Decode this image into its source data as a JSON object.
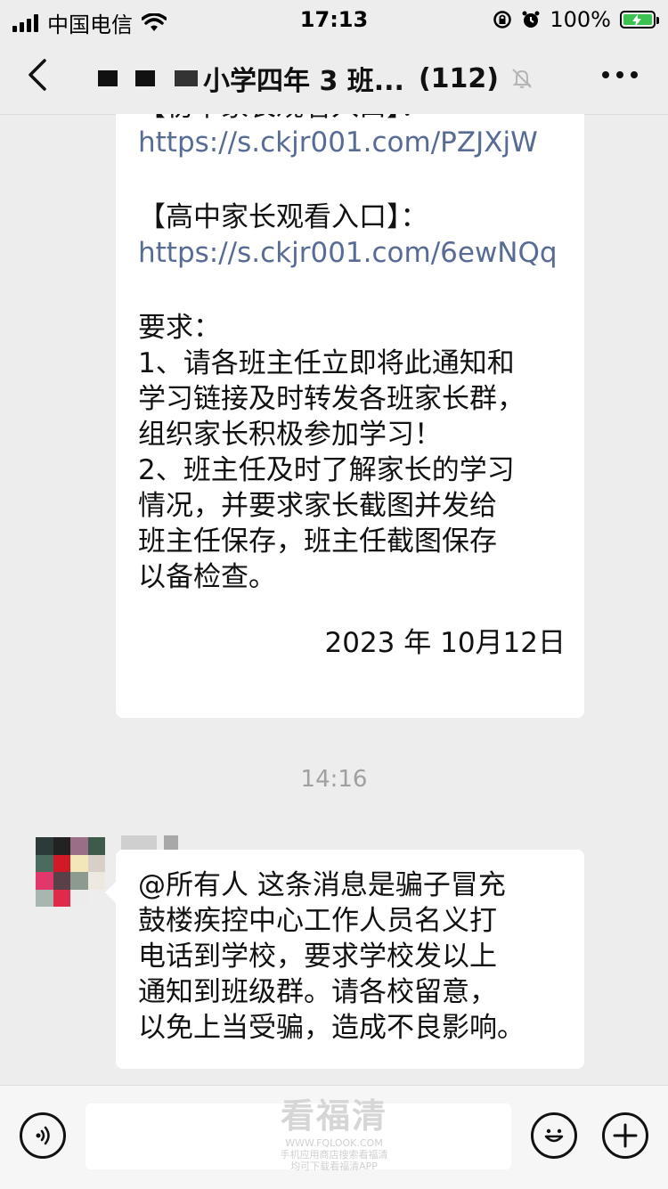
{
  "status_bar": {
    "carrier": "中国电信",
    "time": "17:13",
    "battery": "100%"
  },
  "nav": {
    "title": "小学四年 3 班...",
    "member_count": "(112)"
  },
  "messages": {
    "first": {
      "partial_header": "【初中家长观看入口】：",
      "link1": "https://s.ckjr001.com/PZJXjW",
      "high_header": "【高中家长观看入口】：",
      "link2": "https://s.ckjr001.com/6ewNQq",
      "req_title": "要求：",
      "req1_l1": "1、请各班主任立即将此通知和",
      "req1_l2": "学习链接及时转发各班家长群，",
      "req1_l3": "组织家长积极参加学习！",
      "req2_l1": "2、班主任及时了解家长的学习",
      "req2_l2": "情况，并要求家长截图并发给",
      "req2_l3": "班主任保存，班主任截图保存",
      "req2_l4": "以备检查。",
      "date": "2023 年 10月12日"
    },
    "timestamp": "14:16",
    "second": {
      "l1": "@所有人 这条消息是骗子冒充",
      "l2": "鼓楼疾控中心工作人员名义打",
      "l3": "电话到学校，要求学校发以上",
      "l4": "通知到班级群。请各校留意，",
      "l5": "以免上当受骗，造成不良影响。"
    }
  },
  "watermark": {
    "logo_text": "看福清",
    "url": "WWW.FQLOOK.COM",
    "line1": "手机应用商店搜索看福清",
    "line2": "均可下载看福清APP"
  },
  "colors": {
    "link": "#576b95",
    "battery": "#3cc251",
    "background": "#ededed"
  }
}
